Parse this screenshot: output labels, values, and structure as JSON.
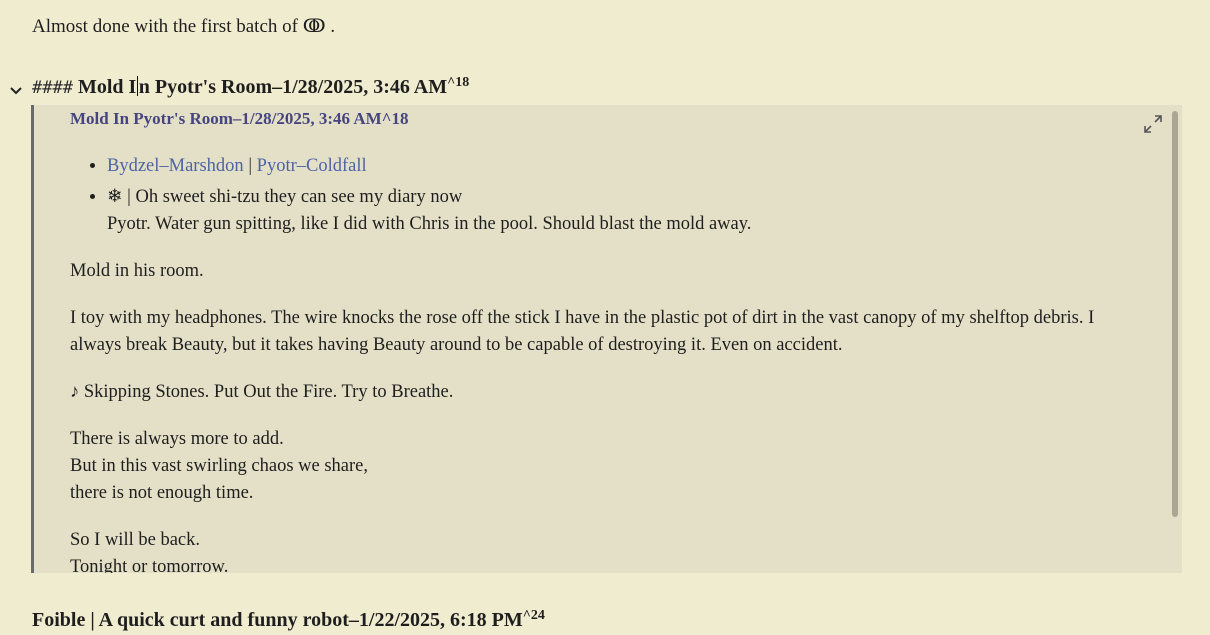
{
  "intro": "Almost done with the first batch of ↂ .",
  "heading": {
    "hashes": "####",
    "title_before_cursor": "Mold I",
    "title_after_cursor": "n Pyotr's Room–1/28/2025, 3:46 AM",
    "suffix": "^18"
  },
  "embed": {
    "title": "Mold In Pyotr's Room–1/28/2025, 3:46 AM^18",
    "links": [
      "Bydzel–Marshdon",
      "Pyotr–Coldfall"
    ],
    "link_separator": "|",
    "bullet2_line1": "❄ | Oh sweet shi-tzu they can see my diary now",
    "bullet2_line2": "Pyotr. Water gun spitting, like I did with Chris in the pool. Should blast the mold away.",
    "p1": "Mold in his room.",
    "p2": "I toy with my headphones. The wire knocks the rose off the stick I have in the plastic pot of dirt in the vast canopy of my shelftop debris. I always break Beauty, but it takes having Beauty around to be capable of destroying it. Even on accident.",
    "p3": "♪ Skipping Stones. Put Out the Fire. Try to Breathe.",
    "poem": [
      "There is always more to add.",
      "But in this vast swirling chaos we share,",
      "there is not enough time."
    ],
    "closing": [
      "So I will be back.",
      "Tonight or tomorrow."
    ]
  },
  "footer_heading": {
    "title": "Foible | A quick curt and funny robot–1/22/2025, 6:18 PM",
    "suffix": "^24"
  },
  "colors": {
    "background": "#f0ecd0",
    "embed_background": "#e3e0c7",
    "link": "#4f63a5",
    "embed_title": "#474580"
  }
}
